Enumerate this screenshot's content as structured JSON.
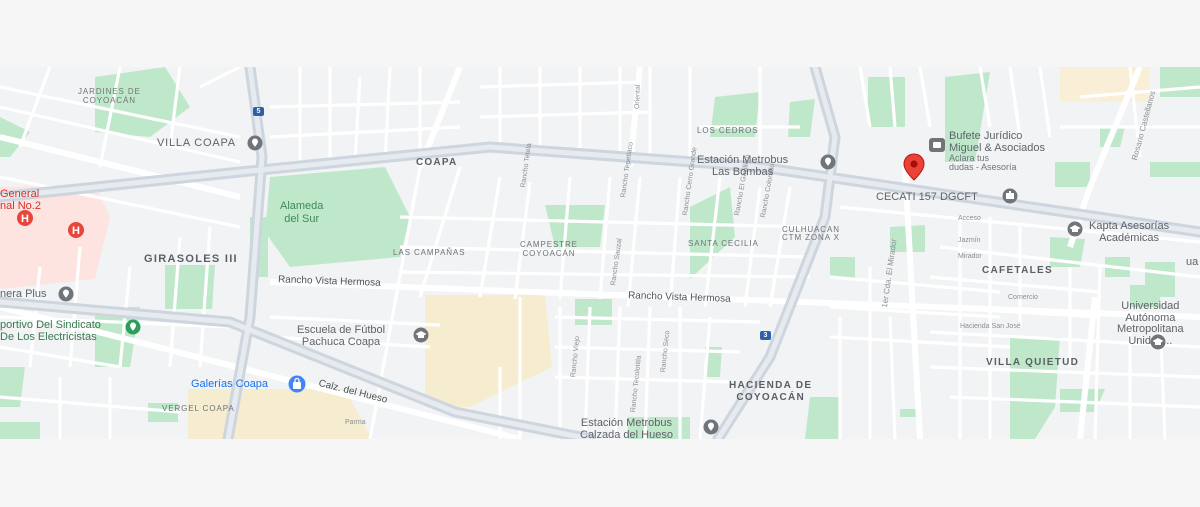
{
  "map": {
    "neighborhoods": {
      "jardines_de_coyoacan": [
        "JARDINES DE",
        "COYOACÁN"
      ],
      "villa_coapa": "VILLA COAPA",
      "coapa": "COAPA",
      "girasoles": "GIRASOLES III",
      "las_campanas": "LAS CAMPAÑAS",
      "campestre_coyoacan": [
        "CAMPESTRE",
        "COYOACÁN"
      ],
      "santa_cecilia": "SANTA CECILIA",
      "los_cedros": "LOS CEDROS",
      "culhuacan": [
        "CULHUACAN",
        "CTM ZONA X"
      ],
      "cafetales": "CAFETALES",
      "villa_quietud": "VILLA QUIETUD",
      "hacienda_de_coyoacan": [
        "HACIENDA DE",
        "COYOACÁN"
      ],
      "vergel_coapa": "VERGEL COAPA"
    },
    "roads": {
      "rancho_vista_hermosa_1": "Rancho Vista Hermosa",
      "rancho_vista_hermosa_2": "Rancho Vista Hermosa",
      "calz_del_hueso": "Calz. del Hueso",
      "tercera_cda_mirador": "1er Cda. El Mirador",
      "rosario_castellanos": "Rosario Castellanos",
      "oriental": "Oriental",
      "parma": "Parma"
    },
    "pois": {
      "alameda_del_sur": [
        "Alameda",
        "del Sur"
      ],
      "estacion_las_bombas": [
        "Estación Metrobus",
        "Las Bombas"
      ],
      "bufete": [
        "Bufete Jurídico",
        "Miguel & Asociados"
      ],
      "bufete_sub": [
        "Aclara tus",
        "dudas - Asesoría"
      ],
      "cecati": "CECATI 157 DGCFT",
      "kapta": [
        "Kapta Asesorías",
        "Académicas"
      ],
      "hospital": [
        "General",
        "nal No.2"
      ],
      "cinema": "nera Plus",
      "deportivo": [
        "portivo Del Sindicato",
        "De Los Electricistas"
      ],
      "escuela": [
        "Escuela de Fútbol",
        "Pachuca Coapa"
      ],
      "galerias": "Galerías Coapa",
      "estacion_hueso": [
        "Estación Metrobus",
        "Calzada del Hueso"
      ],
      "universidad": [
        "Universidad",
        "Autónoma",
        "Metropolitana",
        "Unidad..."
      ],
      "uam_partial": "ua"
    },
    "route_shields": [
      "5",
      "3"
    ],
    "colors": {
      "background": "#f1f3f4",
      "road": "#ffffff",
      "major_road": "#c9d1da",
      "park": "#bfe8cb",
      "commercial": "#f6ecd0",
      "hospital_area": "#fde4e1",
      "marker": "#ea4335"
    },
    "street_labels": [
      "Rancho Tetela",
      "Rancho Tepetlaco",
      "Rancho Sauzal",
      "Rancho Cerro Grande",
      "Rancho Viejo",
      "Rancho Seco",
      "Rancho Tecolotitla",
      "Rancho Colorado",
      "Rancho El Gavillero",
      "Mirador",
      "Comercio",
      "Acceso",
      "Jazmín",
      "Hacienda San José"
    ]
  }
}
